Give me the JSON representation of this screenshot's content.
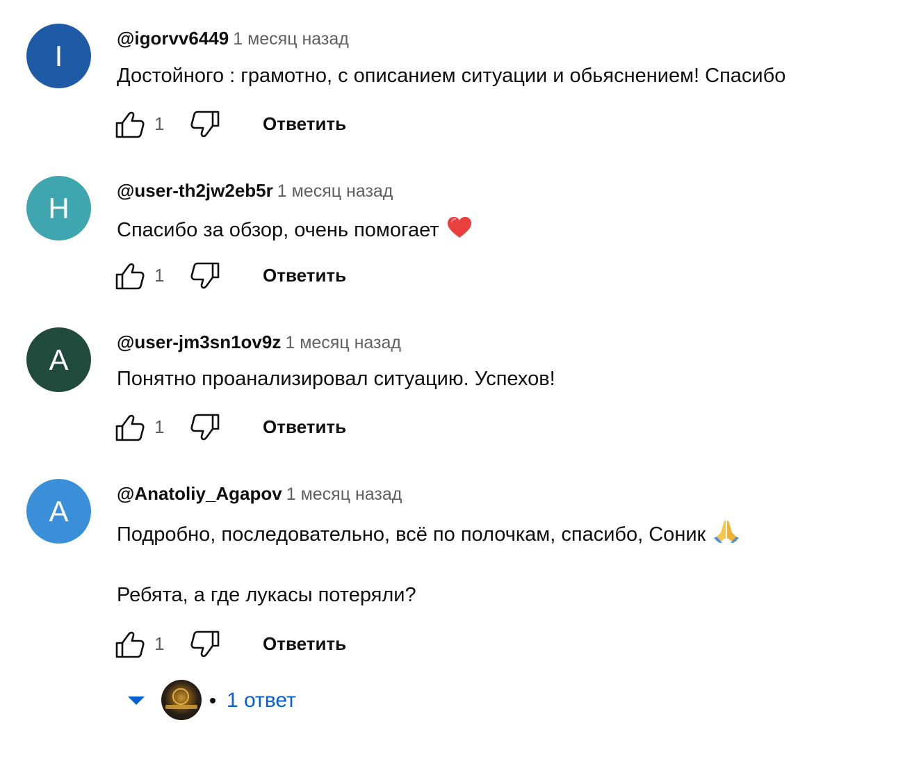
{
  "colors": {
    "author_text": "#0f0f0f",
    "timestamp_text": "#606060",
    "link_blue": "#065fd4"
  },
  "comments": [
    {
      "avatar_letter": "I",
      "avatar_color": "#1f5aa6",
      "author": "@igorvv6449",
      "time": "1 месяц назад",
      "text": "Достойного : грамотно, с описанием ситуации и обьяснением! Спасибо",
      "likes": "1",
      "reply_label": "Ответить"
    },
    {
      "avatar_letter": "H",
      "avatar_color": "#3fa5ae",
      "author": "@user-th2jw2eb5r",
      "time": "1 месяц назад",
      "text": "Спасибо за обзор, очень помогает",
      "emoji": "heart-emoji",
      "likes": "1",
      "reply_label": "Ответить"
    },
    {
      "avatar_letter": "A",
      "avatar_color": "#1f4a3c",
      "author": "@user-jm3sn1ov9z",
      "time": "1 месяц назад",
      "text": "Понятно проанализировал ситуацию. Успехов!",
      "likes": "1",
      "reply_label": "Ответить"
    },
    {
      "avatar_letter": "A",
      "avatar_color": "#3a8fd8",
      "author": "@Anatoliy_Agapov",
      "time": "1 месяц назад",
      "text": "Подробно, последовательно, всё по полочкам, спасибо, Соник",
      "emoji": "folded-hands-emoji",
      "text2": "Ребята, а где лукасы потеряли?",
      "likes": "1",
      "reply_label": "Ответить"
    }
  ],
  "replies_toggle": {
    "label": "1 ответ"
  }
}
